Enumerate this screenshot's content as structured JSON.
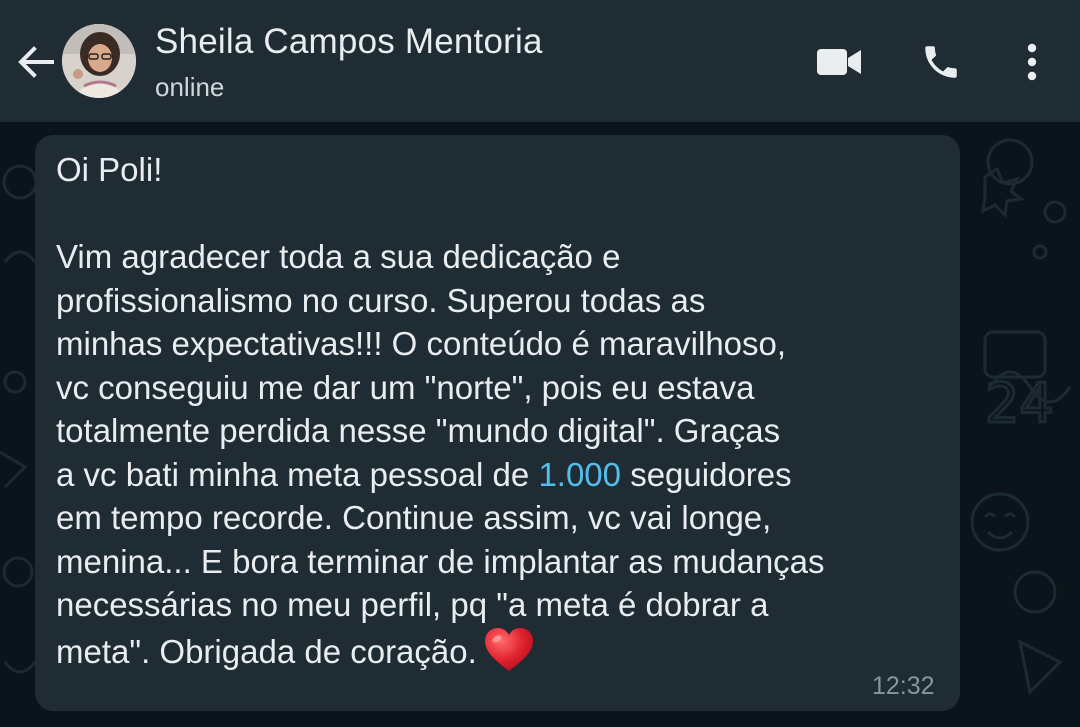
{
  "header": {
    "contact_name": "Sheila Campos Mentoria",
    "status": "online"
  },
  "icons": {
    "back": "arrow-left-icon",
    "video": "video-camera-icon",
    "call": "phone-icon",
    "menu": "more-vertical-icon"
  },
  "message": {
    "greeting": "Oi Poli!",
    "body_part1": "Vim agradecer toda a sua dedicação e\nprofissionalismo no curso. Superou todas as\nminhas expectativas!!! O conteúdo é maravilhoso,\nvc conseguiu me dar um \"norte\", pois eu estava\ntotalmente perdida nesse \"mundo digital\". Graças\na vc bati minha meta pessoal de ",
    "highlight_number": "1.000",
    "body_part2": " seguidores\nem tempo recorde. Continue assim, vc vai longe,\nmenina... E bora terminar de implantar as mudanças\nnecessárias no meu perfil, pq \"a meta é dobrar a\nmeta\". Obrigada de coração.",
    "time": "12:32"
  },
  "colors": {
    "header_bg": "#1f2c34",
    "chat_bg": "#0b141a",
    "bubble_bg": "#1f2c34",
    "text": "#e9edef",
    "link": "#53bdeb",
    "timestamp": "#8696a0",
    "heart": "#e0212d"
  }
}
